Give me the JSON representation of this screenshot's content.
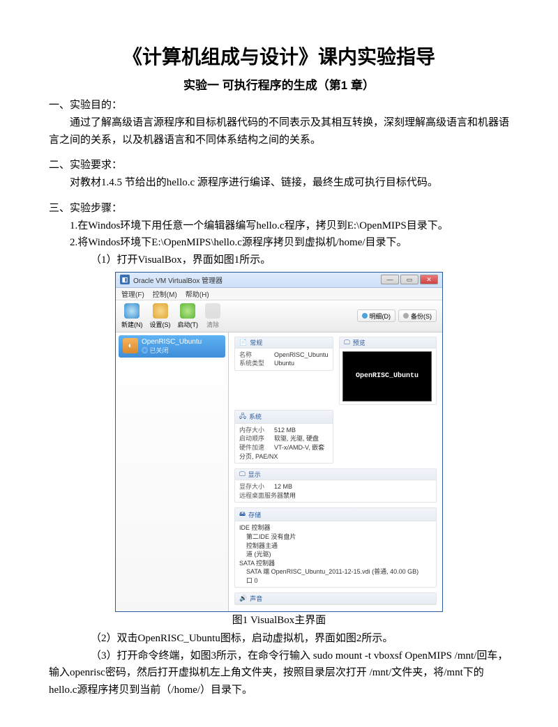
{
  "doc": {
    "title": "《计算机组成与设计》课内实验指导",
    "subtitle": "实验一 可执行程序的生成（第1 章）",
    "purpose_head": "一、实验目的：",
    "purpose_body": "通过了解高级语言源程序和目标机器代码的不同表示及其相互转换，深刻理解高级语言和机器语言之间的关系，以及机器语言和不同体系结构之间的关系。",
    "require_head": "二、实验要求：",
    "require_body": "对教材1.4.5 节给出的hello.c 源程序进行编译、链接，最终生成可执行目标代码。",
    "steps_head": "三、实验步骤：",
    "step1": "1.在Windos环境下用任意一个编辑器编写hello.c程序，拷贝到E:\\OpenMIPS目录下。",
    "step2": "2.将Windos环境下E:\\OpenMIPS\\hello.c源程序拷贝到虚拟机/home/目录下。",
    "step2_1": "（1）打开VisualBox，界面如图1所示。",
    "fig1_caption": "图1 VisualBox主界面",
    "step2_2": "（2）双击OpenRISC_Ubuntu图标，启动虚拟机，界面如图2所示。",
    "step2_3": "（3）打开命令终端，如图3所示，在命令行输入 sudo mount -t vboxsf OpenMIPS /mnt/回车，输入openrisc密码，然后打开虚拟机左上角文件夹，按照目录层次打开 /mnt/文件夹，将/mnt下的hello.c源程序拷贝到当前（/home/）目录下。"
  },
  "vb": {
    "window_title": "Oracle VM VirtualBox 管理器",
    "menu": {
      "m1": "管理(F)",
      "m2": "控制(M)",
      "m3": "帮助(H)"
    },
    "toolbar": {
      "new": "新建(N)",
      "settings": "设置(S)",
      "start": "启动(T)",
      "clear": "清除"
    },
    "rightbtn": {
      "detail": "明细(D)",
      "backup": "备份(S)"
    },
    "vm": {
      "name": "OpenRISC_Ubuntu",
      "state": "已关闭"
    },
    "sections": {
      "general": "常规",
      "general_name_k": "名称",
      "general_name_v": "OpenRISC_Ubuntu",
      "general_os_k": "系统类型",
      "general_os_v": "Ubuntu",
      "preview": "预览",
      "preview_text": "OpenRISC_Ubuntu",
      "system": "系统",
      "sys_mem_k": "内存大小",
      "sys_mem_v": "512 MB",
      "sys_boot_k": "启动顺序",
      "sys_boot_v": "软驱, 光驱, 硬盘",
      "sys_accel_k": "硬件加速",
      "sys_accel_v": "VT-x/AMD-V, 嵌套分页, PAE/NX",
      "display": "显示",
      "disp_mem_k": "显存大小",
      "disp_mem_v": "12 MB",
      "disp_rdp_k": "远程桌面服务器",
      "disp_rdp_v": "禁用",
      "storage": "存储",
      "stor_l1": "IDE 控制器",
      "stor_l2": "第二IDE 没有盘片",
      "stor_l3": "控制器主通",
      "stor_l4": "道 (光驱)",
      "stor_l5": "SATA 控制器",
      "stor_l6": "SATA 端 OpenRISC_Ubuntu_2011-12-15.vdi (普通, 40.00 GB)",
      "stor_l7": "口 0",
      "audio": "声音"
    }
  }
}
